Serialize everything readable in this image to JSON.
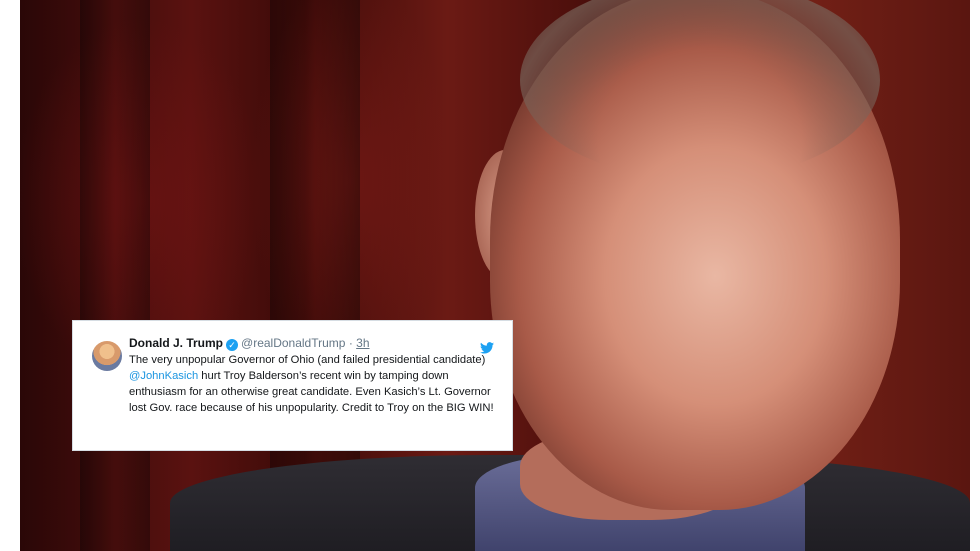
{
  "tweet": {
    "name": "Donald J. Trump",
    "verified_icon": "verified-check-icon",
    "handle": "@realDonaldTrump",
    "separator": "·",
    "time": "3h",
    "text_part1": "The very unpopular Governor of Ohio (and failed presidential candidate) ",
    "mention": "@JohnKasich",
    "text_part2": " hurt Troy Balderson’s recent win by tamping down enthusiasm for an otherwise great candidate. Even Kasich’s Lt. Governor lost Gov. race because of his unpopularity. Credit to Troy on the BIG WIN!",
    "platform_icon": "twitter-bird-icon"
  },
  "colors": {
    "link": "#1b95e0",
    "twitter_blue": "#1da1f2",
    "text": "#14171a",
    "muted": "#657786"
  }
}
